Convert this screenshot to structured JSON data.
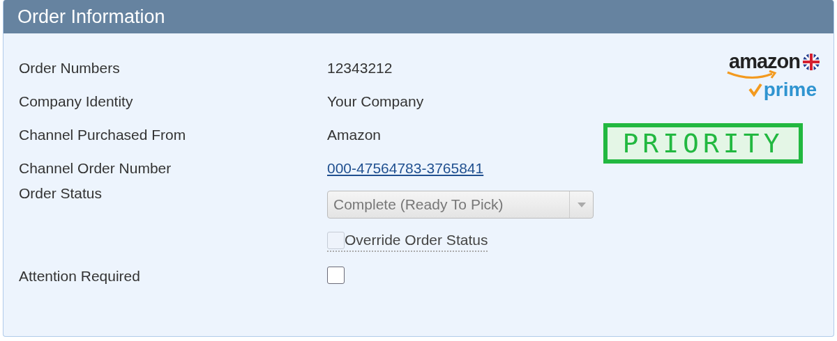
{
  "panel": {
    "title": "Order Information"
  },
  "fields": [
    {
      "kind": "text",
      "label": "Order Numbers",
      "value": "12343212"
    },
    {
      "kind": "text",
      "label": "Company Identity",
      "value": "Your Company"
    },
    {
      "kind": "text",
      "label": "Channel Purchased From",
      "value": "Amazon"
    },
    {
      "kind": "link",
      "label": "Channel Order Number",
      "value": "000-47564783-3765841"
    },
    {
      "kind": "select",
      "label": "Order Status",
      "value": "Complete (Ready To Pick)",
      "disabled": true
    },
    {
      "kind": "option",
      "option": "Override Order Status",
      "checked": false,
      "disabled": true
    },
    {
      "kind": "checkbox",
      "label": "Attention Required",
      "checked": false,
      "disabled": false
    }
  ],
  "badges": {
    "brand": "amazon",
    "program": "prime",
    "stamp": "PRIORITY"
  }
}
